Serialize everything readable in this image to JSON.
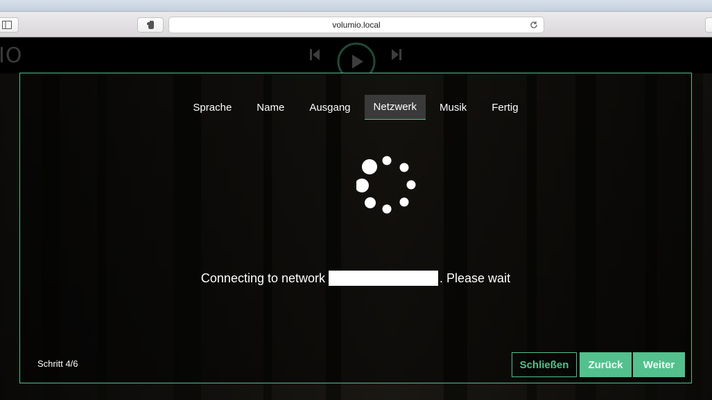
{
  "browser": {
    "url": "volumio.local"
  },
  "app": {
    "logo_text": "IO"
  },
  "wizard": {
    "tabs": [
      {
        "label": "Sprache"
      },
      {
        "label": "Name"
      },
      {
        "label": "Ausgang"
      },
      {
        "label": "Netzwerk",
        "active": true
      },
      {
        "label": "Musik"
      },
      {
        "label": "Fertig"
      }
    ],
    "status_prefix": "Connecting to network",
    "status_suffix": ". Please wait",
    "step_label": "Schritt 4/6",
    "buttons": {
      "close": "Schließen",
      "back": "Zurück",
      "next": "Weiter"
    }
  },
  "colors": {
    "accent": "#54c08d",
    "active_tab_bg": "#3a3a3a"
  }
}
